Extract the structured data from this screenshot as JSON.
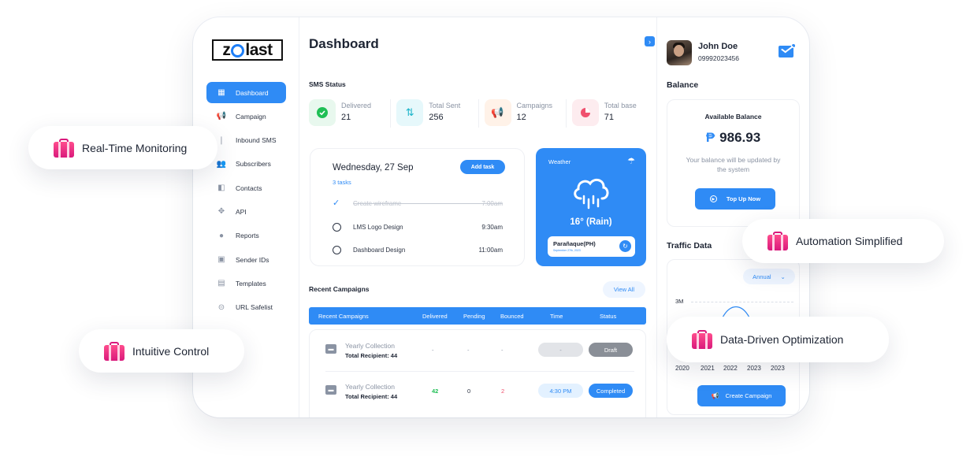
{
  "logo": {
    "text_left": "z",
    "text_right": "last"
  },
  "sidebar": {
    "items": [
      {
        "label": "Dashboard",
        "icon": "grid-icon",
        "active": true
      },
      {
        "label": "Campaign",
        "icon": "megaphone-icon"
      },
      {
        "label": "Inbound SMS",
        "icon": "inbound-icon"
      },
      {
        "label": "Subscribers",
        "icon": "subscribers-icon"
      },
      {
        "label": "Contacts",
        "icon": "contacts-icon"
      },
      {
        "label": "API",
        "icon": "api-icon"
      },
      {
        "label": "Reports",
        "icon": "reports-icon"
      },
      {
        "label": "Sender IDs",
        "icon": "id-badge-icon"
      },
      {
        "label": "Templates",
        "icon": "template-icon"
      },
      {
        "label": "URL Safelist",
        "icon": "link-icon"
      }
    ]
  },
  "main": {
    "title": "Dashboard",
    "sms_status": {
      "title": "SMS Status",
      "stats": [
        {
          "label": "Delivered",
          "value": "21",
          "color": "#1fbf55",
          "bg": "#e8f8ee"
        },
        {
          "label": "Total Sent",
          "value": "256",
          "color": "#19b3c9",
          "bg": "#e6f8fb"
        },
        {
          "label": "Campaigns",
          "value": "12",
          "color": "#ff9a4d",
          "bg": "#fff2e8"
        },
        {
          "label": "Total base",
          "value": "71",
          "color": "#f0506e",
          "bg": "#fdecef"
        }
      ]
    },
    "tasks": {
      "date": "Wednesday, 27 Sep",
      "count": "3 tasks",
      "add_label": "Add task",
      "items": [
        {
          "title": "Create wireframe",
          "time": "7:00am",
          "done": true
        },
        {
          "title": "LMS Logo Design",
          "time": "9:30am",
          "done": false
        },
        {
          "title": "Dashboard Design",
          "time": "11:00am",
          "done": false
        }
      ]
    },
    "weather": {
      "title": "Weather",
      "temp": "16° (Rain)",
      "location": "Parañaque(PH)",
      "date": "September 27th, 2023"
    },
    "recent": {
      "title": "Recent Campaigns",
      "view_all": "View All",
      "columns": [
        "Recent Campaigns",
        "Delivered",
        "Pending",
        "Bounced",
        "Time",
        "Status"
      ],
      "rows": [
        {
          "name": "Yearly Collection",
          "sub": "Total Recipient: 44",
          "delivered": "-",
          "pending": "-",
          "bounced": "-",
          "time": "-",
          "status": "Draft"
        },
        {
          "name": "Yearly Collection",
          "sub": "Total Recipient: 44",
          "delivered": "42",
          "pending": "0",
          "bounced": "2",
          "time": "4:30 PM",
          "status": "Completed"
        }
      ]
    }
  },
  "right": {
    "user": {
      "name": "John Doe",
      "phone": "09992023456"
    },
    "balance": {
      "title": "Balance",
      "label": "Available Balance",
      "currency": "₱",
      "value": "986.93",
      "note": "Your balance will be updated by the system",
      "topup": "Top Up Now"
    },
    "traffic": {
      "title": "Traffic Data",
      "filter": "Annual",
      "y_label": "3M",
      "years": [
        "2020",
        "2021",
        "2022",
        "2023",
        "2023"
      ],
      "create": "Create Campaign"
    }
  },
  "pills": {
    "realtime": "Real-Time Monitoring",
    "intuitive": "Intuitive Control",
    "automation": "Automation Simplified",
    "data": "Data-Driven Optimization"
  },
  "colors": {
    "accent": "#2f8bf5",
    "pill_icon": "#e0207f"
  }
}
